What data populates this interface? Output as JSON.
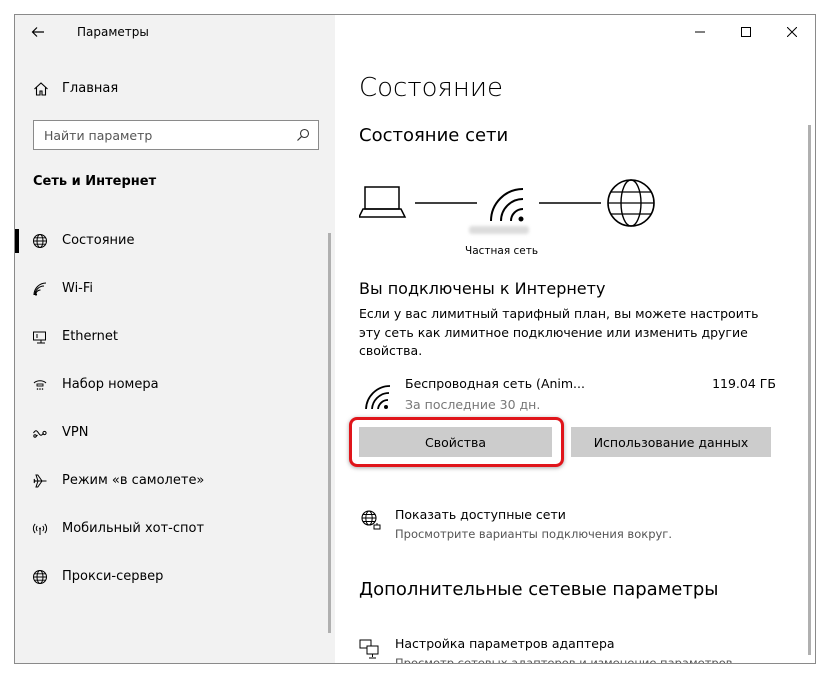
{
  "window": {
    "title": "Параметры"
  },
  "sidebar": {
    "home_label": "Главная",
    "search_placeholder": "Найти параметр",
    "section_title": "Сеть и Интернет",
    "items": [
      {
        "label": "Состояние",
        "icon": "globe-icon"
      },
      {
        "label": "Wi-Fi",
        "icon": "wifi-icon"
      },
      {
        "label": "Ethernet",
        "icon": "ethernet-icon"
      },
      {
        "label": "Набор номера",
        "icon": "dialup-icon"
      },
      {
        "label": "VPN",
        "icon": "vpn-icon"
      },
      {
        "label": "Режим «в самолете»",
        "icon": "airplane-icon"
      },
      {
        "label": "Мобильный хот-спот",
        "icon": "hotspot-icon"
      },
      {
        "label": "Прокси-сервер",
        "icon": "globe-icon"
      }
    ]
  },
  "main": {
    "title": "Состояние",
    "network_status_title": "Состояние сети",
    "network_label": "Частная сеть",
    "connected_title": "Вы подключены к Интернету",
    "connected_desc": "Если у вас лимитный тарифный план, вы можете настроить эту сеть как лимитное подключение или изменить другие свойства.",
    "network_name": "Беспроводная сеть (Anim...",
    "network_period": "За последние 30 дн.",
    "network_usage": "119.04 ГБ",
    "properties_button": "Свойства",
    "data_usage_button": "Использование данных",
    "show_networks_title": "Показать доступные сети",
    "show_networks_desc": "Просмотрите варианты подключения вокруг.",
    "advanced_title": "Дополнительные сетевые параметры",
    "adapter_title": "Настройка параметров адаптера",
    "adapter_desc": "Просмотр сетевых адаптеров и изменение параметров"
  },
  "colors": {
    "sidebar_bg": "#f2f2f2",
    "button_bg": "#cccccc",
    "highlight": "#e0151b"
  }
}
